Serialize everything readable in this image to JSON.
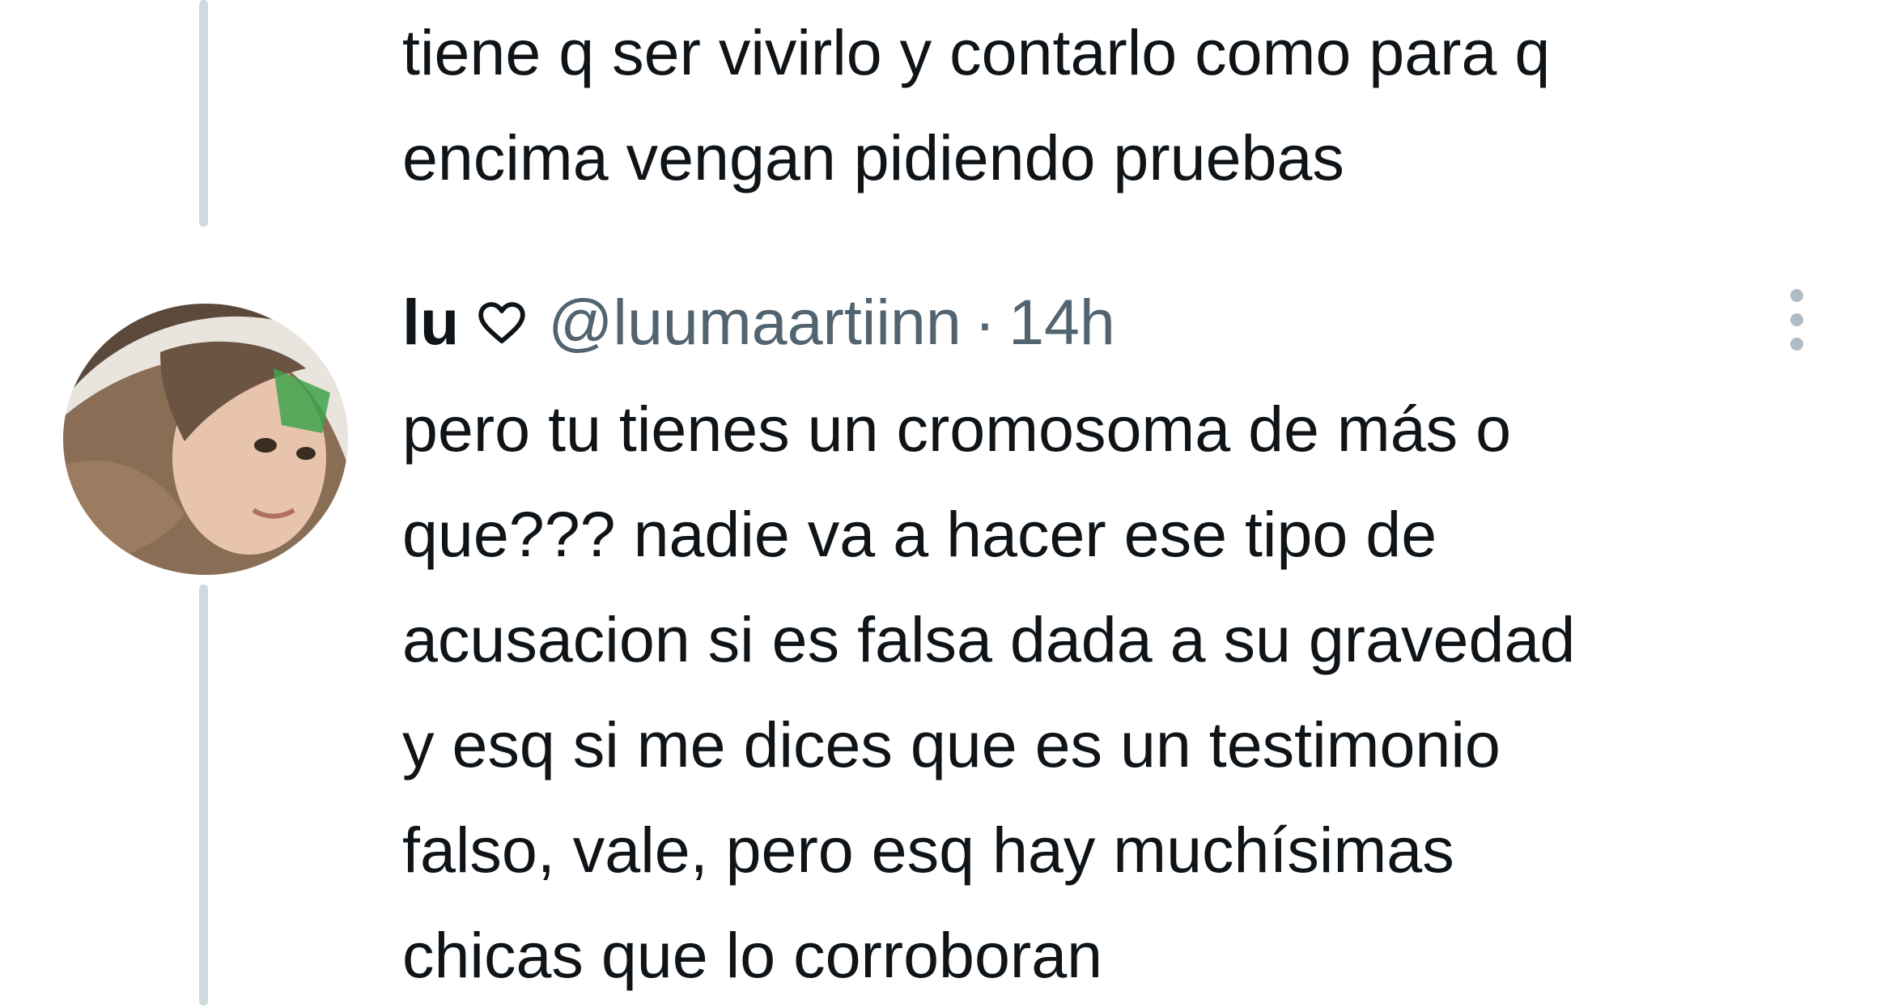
{
  "previous_tweet": {
    "text_line_1": "tiene q ser vivirlo y contarlo como para q",
    "text_line_2": "encima vengan pidiendo pruebas"
  },
  "reply_tweet": {
    "display_name": "lu",
    "name_icon": "heart-outline-icon",
    "handle": "@luumaartiinn",
    "separator": "·",
    "timestamp": "14h",
    "more_icon": "more-vertical-icon",
    "text_lines": [
      "pero tu tienes un cromosoma de más o",
      "que??? nadie va a hacer ese tipo de",
      "acusacion si es falsa dada a su gravedad",
      "y esq si me dices que es un testimonio",
      "falso, vale, pero esq hay muchísimas",
      "chicas que lo corroboran"
    ]
  },
  "colors": {
    "text": "#0f1419",
    "secondary": "#536471",
    "thread_line": "#cfd9de",
    "background": "#ffffff"
  }
}
